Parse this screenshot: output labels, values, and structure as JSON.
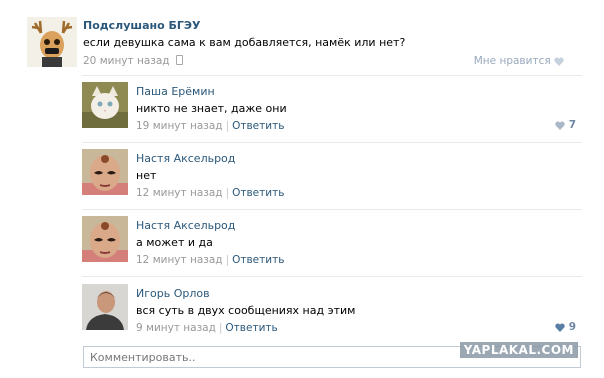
{
  "post": {
    "author": "Подслушано БГЭУ",
    "text": "если девушка сама к вам добавляется, намёк или нет?",
    "time": "20 минут назад",
    "like_label": "Мне нравится"
  },
  "reply_label": "Ответить",
  "comments": [
    {
      "author": "Паша Ерёмин",
      "text": "никто не знает, даже они",
      "time": "19 минут назад",
      "likes": "7"
    },
    {
      "author": "Настя Аксельрод",
      "text": "нет",
      "time": "12 минут назад",
      "likes": ""
    },
    {
      "author": "Настя Аксельрод",
      "text": "а может и да",
      "time": "12 минут назад",
      "likes": ""
    },
    {
      "author": "Игорь Орлов",
      "text": "вся суть в двух сообщениях над этим",
      "time": "9 минут назад",
      "likes": "9"
    }
  ],
  "comment_input": {
    "placeholder": "Комментировать.."
  },
  "watermark": "YAPLAKAL.COM",
  "colors": {
    "link": "#2b587a",
    "meta": "#999999",
    "like": "#6e87a5"
  }
}
